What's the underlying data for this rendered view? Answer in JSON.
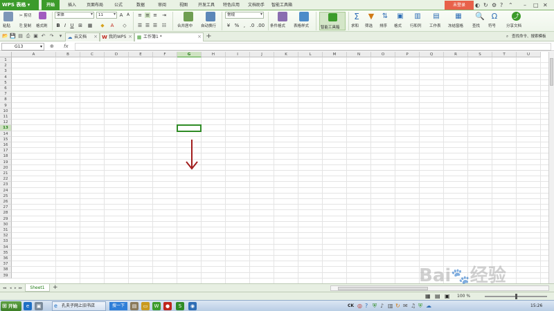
{
  "app": {
    "name": "WPS 表格"
  },
  "menu": {
    "tabs": [
      "开始",
      "插入",
      "页面布局",
      "公式",
      "数据",
      "审阅",
      "视图",
      "开发工具",
      "特色应用",
      "文档助手",
      "智能工具箱"
    ],
    "active_tab": "开始",
    "login_label": "未登录"
  },
  "ribbon": {
    "paste": "粘贴",
    "cut": "剪切",
    "copy": "复制",
    "format_painter": "格式刷",
    "font_name": "宋体",
    "font_size": "11",
    "merge_center": "合并居中",
    "wrap_text": "自动换行",
    "number_format": "常规",
    "conditional_format": "条件格式",
    "table_style": "表格样式",
    "smart_toolbox": "智能工具箱",
    "sum": "求和",
    "filter": "筛选",
    "sort": "排序",
    "format": "格式",
    "row_col": "行和列",
    "worksheet": "工作表",
    "freeze": "冻结窗格",
    "find": "查找",
    "symbol": "符号",
    "share": "分享文档"
  },
  "doc_tabs": [
    {
      "label": "云文档"
    },
    {
      "label": "我的WPS"
    },
    {
      "label": "工作簿1 *"
    }
  ],
  "find_box": {
    "placeholder": "查找命令、搜索模板"
  },
  "formula_bar": {
    "cell_ref": "G13",
    "fx_label": "fx",
    "value": ""
  },
  "grid": {
    "columns": [
      "A",
      "B",
      "C",
      "D",
      "E",
      "F",
      "G",
      "H",
      "I",
      "J",
      "K",
      "L",
      "M",
      "N",
      "O",
      "P",
      "Q",
      "R",
      "S",
      "T",
      "U"
    ],
    "rows": [
      "1",
      "2",
      "3",
      "4",
      "5",
      "6",
      "7",
      "8",
      "9",
      "10",
      "11",
      "12",
      "13",
      "14",
      "15",
      "16",
      "17",
      "18",
      "19",
      "20",
      "21",
      "22",
      "23",
      "24",
      "25",
      "26",
      "27",
      "28",
      "29",
      "30",
      "31",
      "32",
      "33",
      "34",
      "35",
      "36",
      "37",
      "38",
      "39"
    ],
    "selected_column": "G",
    "selected_row": "13"
  },
  "sheets": {
    "tabs": [
      "Sheet1"
    ],
    "active": "Sheet1"
  },
  "status": {
    "zoom": "100 %"
  },
  "taskbar": {
    "start_label": "开始",
    "app_label": "孔夫子网上旧书店",
    "search_label": "搜一下",
    "clock": "15:26"
  },
  "colors": {
    "brand_green": "#3c9b2b",
    "selection": "#2e8b25",
    "login_red": "#e8614a",
    "arrow": "#a11c1c"
  }
}
